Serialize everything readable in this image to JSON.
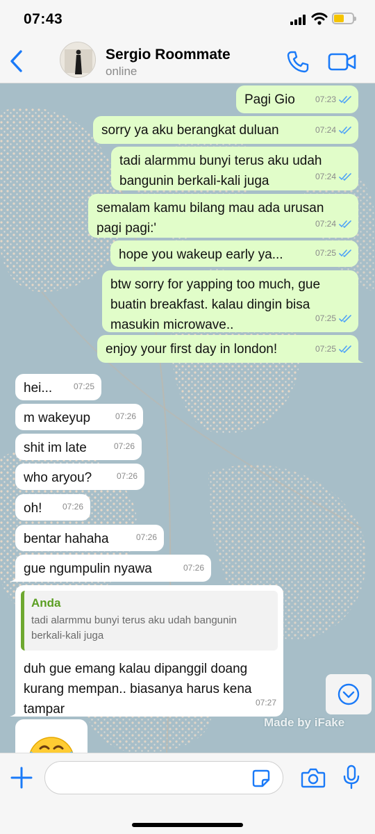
{
  "status_bar": {
    "time": "07:43",
    "battery_color": "#f5c400"
  },
  "header": {
    "contact_name": "Sergio Roommate",
    "status": "online"
  },
  "colors": {
    "accent": "#1a7af8",
    "outgoing_bubble": "#e1fdc9",
    "incoming_bubble": "#ffffff",
    "read_ticks": "#4fa3f7",
    "quote_bar": "#6ea830"
  },
  "messages": [
    {
      "direction": "out",
      "text": "Pagi Gio",
      "time": "07:23",
      "read": true
    },
    {
      "direction": "out",
      "text": "sorry ya aku berangkat duluan",
      "time": "07:24",
      "read": true
    },
    {
      "direction": "out",
      "text": "tadi alarmmu bunyi terus aku udah\nbangunin berkali-kali juga",
      "time": "07:24",
      "read": true
    },
    {
      "direction": "out",
      "text": "semalam kamu bilang mau ada urusan\npagi pagi:'",
      "time": "07:24",
      "read": true
    },
    {
      "direction": "out",
      "text": "hope you wakeup early ya...",
      "time": "07:25",
      "read": true
    },
    {
      "direction": "out",
      "text": "btw sorry for yapping too much, gue\nbuatin breakfast. kalau dingin bisa\nmasukin microwave..",
      "time": "07:25",
      "read": true
    },
    {
      "direction": "out",
      "text": "enjoy your first day in london!",
      "time": "07:25",
      "read": true
    },
    {
      "direction": "in",
      "text": "hei...",
      "time": "07:25"
    },
    {
      "direction": "in",
      "text": "m wakeyup",
      "time": "07:26"
    },
    {
      "direction": "in",
      "text": "shit im late",
      "time": "07:26"
    },
    {
      "direction": "in",
      "text": "who aryou?",
      "time": "07:26"
    },
    {
      "direction": "in",
      "text": "oh!",
      "time": "07:26"
    },
    {
      "direction": "in",
      "text": "bentar hahaha",
      "time": "07:26"
    },
    {
      "direction": "in",
      "text": "gue ngumpulin nyawa",
      "time": "07:26"
    },
    {
      "direction": "in",
      "quote": {
        "sender": "Anda",
        "text": "tadi alarmmu bunyi terus aku udah bangunin\nberkali-kali juga"
      },
      "text": "duh gue emang kalau dipanggil doang\nkurang mempan.. biasanya harus kena\ntampar",
      "time": "07:27"
    },
    {
      "direction": "in",
      "emoji": "😂",
      "icon": "face-with-tears-of-joy-icon"
    }
  ],
  "watermark": "Made by iFake",
  "composer": {
    "placeholder": ""
  }
}
